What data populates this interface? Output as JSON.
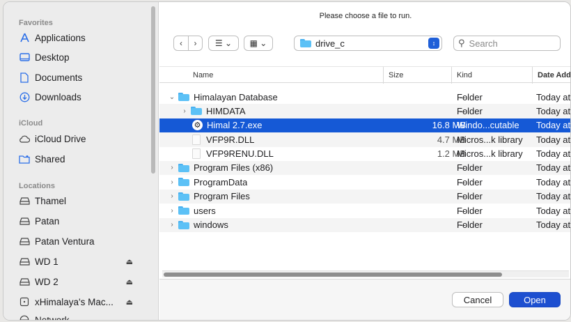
{
  "sidebar": {
    "sections": {
      "favorites": "Favorites",
      "icloud": "iCloud",
      "locations": "Locations"
    },
    "favorites": [
      {
        "label": "Applications",
        "icon": "applications-icon"
      },
      {
        "label": "Desktop",
        "icon": "desktop-icon"
      },
      {
        "label": "Documents",
        "icon": "document-icon"
      },
      {
        "label": "Downloads",
        "icon": "downloads-icon"
      }
    ],
    "icloud": [
      {
        "label": "iCloud Drive",
        "icon": "cloud-icon"
      },
      {
        "label": "Shared",
        "icon": "shared-folder-icon"
      }
    ],
    "locations": [
      {
        "label": "Thamel",
        "icon": "drive-icon"
      },
      {
        "label": "Patan",
        "icon": "drive-icon"
      },
      {
        "label": "Patan Ventura",
        "icon": "drive-icon"
      },
      {
        "label": "WD 1",
        "icon": "drive-icon",
        "eject": true
      },
      {
        "label": "WD 2",
        "icon": "drive-icon",
        "eject": true
      },
      {
        "label": "xHimalaya's Mac...",
        "icon": "computer-icon",
        "eject": true
      },
      {
        "label": "Network",
        "icon": "network-icon"
      }
    ]
  },
  "main": {
    "prompt": "Please choose a file to run.",
    "path": "drive_c",
    "search_placeholder": "Search",
    "columns": {
      "name": "Name",
      "size": "Size",
      "kind": "Kind",
      "date": "Date Add"
    },
    "rows": [
      {
        "indent": 0,
        "chevron": "open",
        "type": "folder",
        "name": "Himalayan Database",
        "size": "--",
        "kind": "Folder",
        "date": "Today at"
      },
      {
        "indent": 1,
        "chevron": "closed",
        "type": "folder",
        "name": "HIMDATA",
        "size": "--",
        "kind": "Folder",
        "date": "Today at"
      },
      {
        "indent": 1,
        "chevron": "none",
        "type": "exe",
        "name": "Himal 2.7.exe",
        "size": "16.8 MB",
        "kind": "Windo...cutable",
        "date": "Today at",
        "selected": true
      },
      {
        "indent": 1,
        "chevron": "none",
        "type": "file",
        "name": "VFP9R.DLL",
        "size": "4.7 MB",
        "kind": "Micros...k library",
        "date": "Today at"
      },
      {
        "indent": 1,
        "chevron": "none",
        "type": "file",
        "name": "VFP9RENU.DLL",
        "size": "1.2 MB",
        "kind": "Micros...k library",
        "date": "Today at"
      },
      {
        "indent": 0,
        "chevron": "closed",
        "type": "folder",
        "name": "Program Files (x86)",
        "size": "--",
        "kind": "Folder",
        "date": "Today at"
      },
      {
        "indent": 0,
        "chevron": "closed",
        "type": "folder",
        "name": "ProgramData",
        "size": "--",
        "kind": "Folder",
        "date": "Today at"
      },
      {
        "indent": 0,
        "chevron": "closed",
        "type": "folder",
        "name": "Program Files",
        "size": "--",
        "kind": "Folder",
        "date": "Today at"
      },
      {
        "indent": 0,
        "chevron": "closed",
        "type": "folder",
        "name": "users",
        "size": "--",
        "kind": "Folder",
        "date": "Today at"
      },
      {
        "indent": 0,
        "chevron": "closed",
        "type": "folder",
        "name": "windows",
        "size": "--",
        "kind": "Folder",
        "date": "Today at"
      }
    ]
  },
  "footer": {
    "cancel_label": "Cancel",
    "open_label": "Open"
  },
  "colors": {
    "selection": "#1559d6",
    "folder": "#5cc1f6",
    "primary_button": "#1d4fd0"
  }
}
